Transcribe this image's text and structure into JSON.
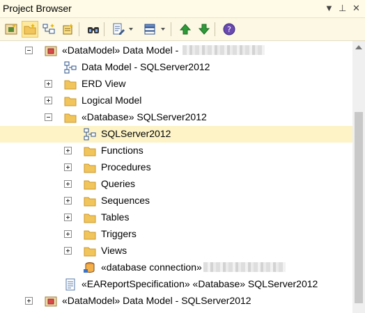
{
  "window": {
    "title": "Project Browser",
    "controls": [
      "▼",
      "⊥",
      "✕"
    ]
  },
  "toolbar": {
    "buttons": [
      {
        "icon": "new-model-icon"
      },
      {
        "icon": "new-folder-icon",
        "active": true
      },
      {
        "icon": "new-diagram-icon"
      },
      {
        "icon": "new-element-icon"
      },
      {
        "icon": "find-icon"
      },
      {
        "icon": "edit-document-icon",
        "dropdown": true
      },
      {
        "icon": "views-icon",
        "dropdown": true
      },
      {
        "icon": "move-up-icon"
      },
      {
        "icon": "move-down-icon"
      },
      {
        "icon": "help-icon"
      }
    ]
  },
  "tree": {
    "selected_index": 4,
    "items": [
      {
        "label": "«DataModel» Data Model - ",
        "redacted": true,
        "icon": "package-icon",
        "expander": "minus",
        "level": 1
      },
      {
        "label": "Data Model - SQLServer2012",
        "icon": "diagram-icon",
        "expander": "none",
        "level": 2
      },
      {
        "label": "ERD View",
        "icon": "folder-icon",
        "expander": "plus",
        "level": 2
      },
      {
        "label": "Logical Model",
        "icon": "folder-icon",
        "expander": "plus",
        "level": 2
      },
      {
        "label": "«Database» SQLServer2012",
        "icon": "folder-icon",
        "expander": "minus",
        "level": 2
      },
      {
        "label": "SQLServer2012",
        "icon": "diagram-icon",
        "expander": "none",
        "level": 3
      },
      {
        "label": "Functions",
        "icon": "folder-icon",
        "expander": "plus",
        "level": 3
      },
      {
        "label": "Procedures",
        "icon": "folder-icon",
        "expander": "plus",
        "level": 3
      },
      {
        "label": "Queries",
        "icon": "folder-icon",
        "expander": "plus",
        "level": 3
      },
      {
        "label": "Sequences",
        "icon": "folder-icon",
        "expander": "plus",
        "level": 3
      },
      {
        "label": "Tables",
        "icon": "folder-icon",
        "expander": "plus",
        "level": 3
      },
      {
        "label": "Triggers",
        "icon": "folder-icon",
        "expander": "plus",
        "level": 3
      },
      {
        "label": "Views",
        "icon": "folder-icon",
        "expander": "plus",
        "level": 3
      },
      {
        "label": "«database connection»",
        "redacted": true,
        "icon": "database-connection-icon",
        "expander": "none",
        "level": 3
      },
      {
        "label": "«EAReportSpecification» «Database» SQLServer2012",
        "icon": "report-spec-icon",
        "expander": "none",
        "level": 2
      },
      {
        "label": "«DataModel» Data Model - SQLServer2012",
        "icon": "package-icon",
        "expander": "plus",
        "level": 1
      }
    ]
  },
  "colors": {
    "title_bg": "#fffbe6",
    "toolbar_bg": "#fdf8e3",
    "selection_bg": "#fdf3c7",
    "folder": "#f2c55c"
  }
}
